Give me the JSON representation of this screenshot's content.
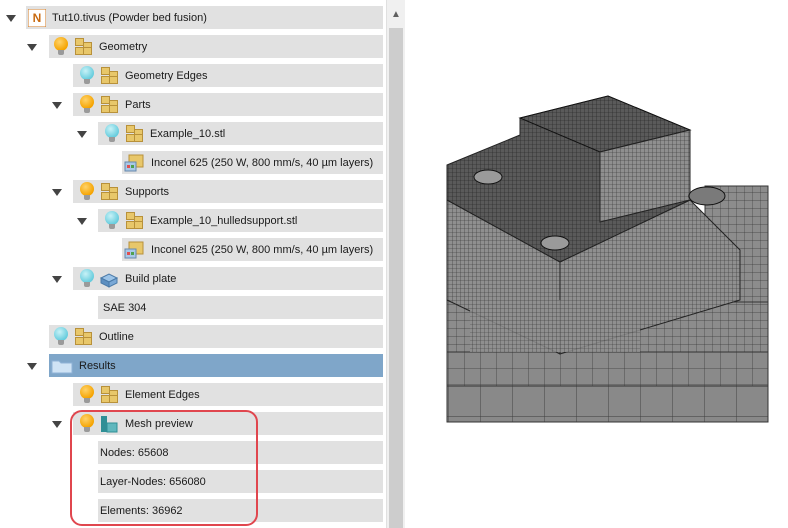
{
  "tree": {
    "root": {
      "label": "Tut10.tivus (Powder bed fusion)"
    },
    "geometry": {
      "label": "Geometry",
      "edges_label": "Geometry Edges",
      "parts": {
        "label": "Parts",
        "file_label": "Example_10.stl",
        "material_label": "Inconel 625 (250 W, 800 mm/s, 40 µm layers)"
      },
      "supports": {
        "label": "Supports",
        "file_label": "Example_10_hulledsupport.stl",
        "material_label": "Inconel 625 (250 W, 800 mm/s, 40 µm layers)"
      },
      "build_plate": {
        "label": "Build plate",
        "material_label": "SAE 304"
      },
      "outline_label": "Outline"
    },
    "results": {
      "label": "Results",
      "element_edges_label": "Element Edges",
      "mesh_preview": {
        "label": "Mesh preview",
        "nodes_label": "Nodes: 65608",
        "layer_nodes_label": "Layer-Nodes: 656080",
        "elements_label": "Elements: 36962"
      }
    }
  },
  "icons": {
    "expand": "triangle-down-icon",
    "visibility_on": "lightbulb-on-icon",
    "visibility_off": "lightbulb-off-icon",
    "group": "cubes-icon",
    "material": "material-icon",
    "plate": "build-plate-icon",
    "mesh": "mesh-icon",
    "folder": "folder-icon",
    "app": "app-logo-icon",
    "scroll_up": "scroll-up-arrow-icon"
  },
  "colors": {
    "row_bg": "#e1e1e1",
    "selected_bg": "#7fa6c9",
    "bulb_on": "#f5a300",
    "bulb_off": "#66ccdd",
    "highlight": "#e0464e",
    "mesh_grey": "#8a8a8a"
  }
}
